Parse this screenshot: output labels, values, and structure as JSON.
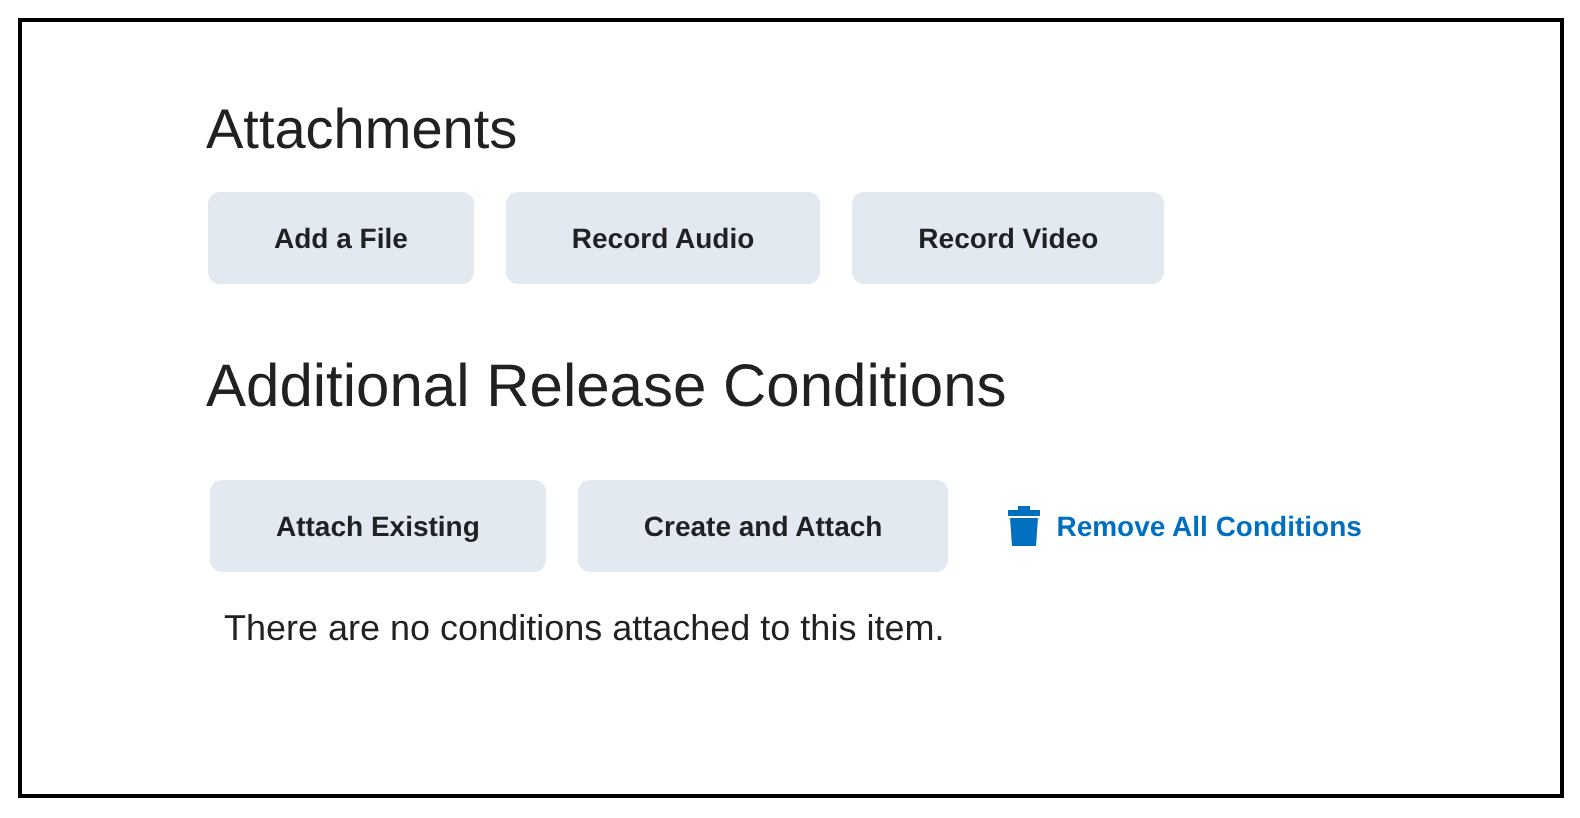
{
  "attachments": {
    "title": "Attachments",
    "buttons": [
      "Add a File",
      "Record Audio",
      "Record Video"
    ]
  },
  "release_conditions": {
    "title": "Additional Release Conditions",
    "buttons": [
      "Attach Existing",
      "Create and Attach"
    ],
    "remove_link": "Remove All Conditions",
    "empty_message": "There are no conditions attached to this item."
  }
}
